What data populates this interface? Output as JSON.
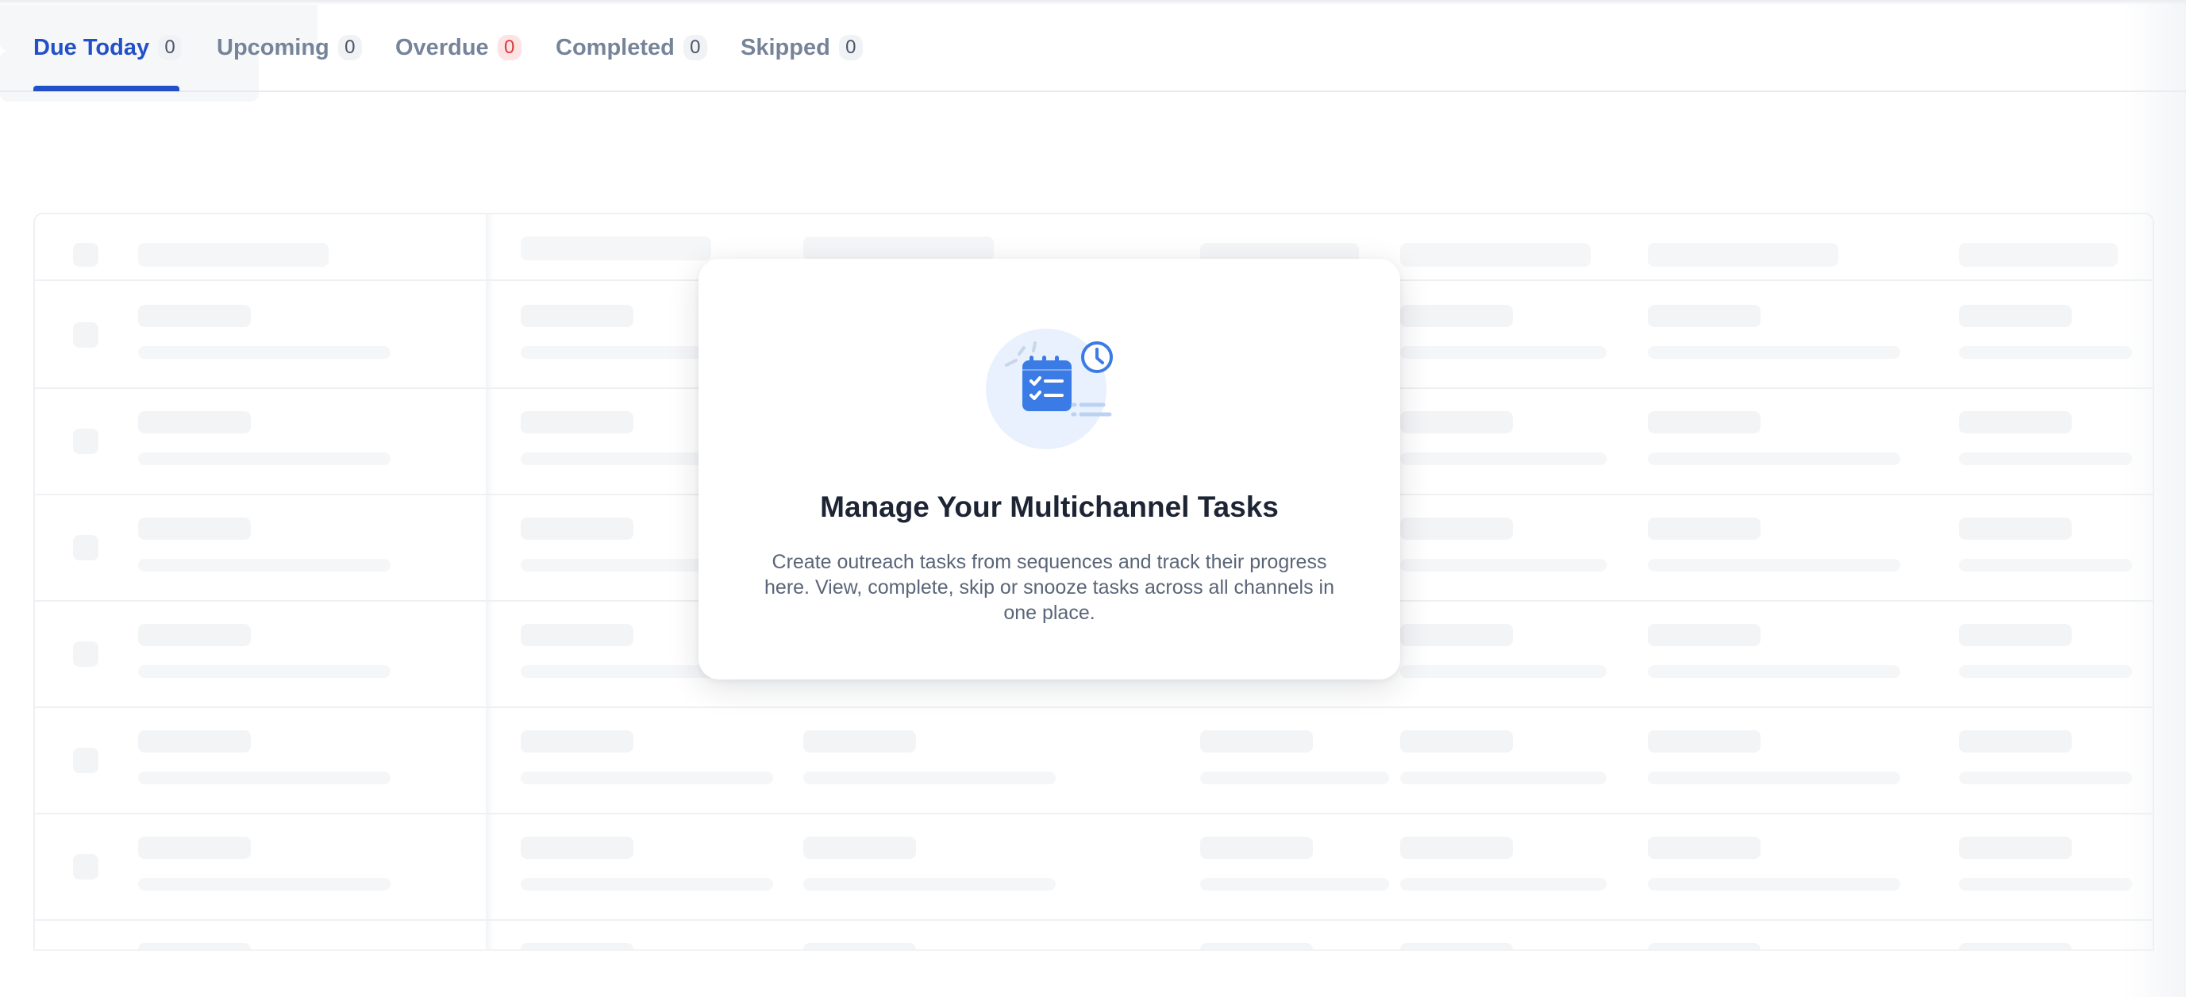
{
  "tabs": [
    {
      "label": "Due Today",
      "count": "0"
    },
    {
      "label": "Upcoming",
      "count": "0"
    },
    {
      "label": "Overdue",
      "count": "0"
    },
    {
      "label": "Completed",
      "count": "0"
    },
    {
      "label": "Skipped",
      "count": "0"
    }
  ],
  "active_tab": "Due Today",
  "empty_state": {
    "title": "Manage Your Multichannel Tasks",
    "description": "Create outreach tasks from sequences and track their progress here. View, complete, skip or snooze tasks across all channels in one place.",
    "icon": "calendar-checklist-clock-icon"
  },
  "colors": {
    "accent": "#2150c8",
    "overdue_badge_bg": "#fde3e3",
    "overdue_badge_text": "#d93a3a",
    "icon_blue": "#3b7be6",
    "icon_circle": "#e8f1fd"
  }
}
